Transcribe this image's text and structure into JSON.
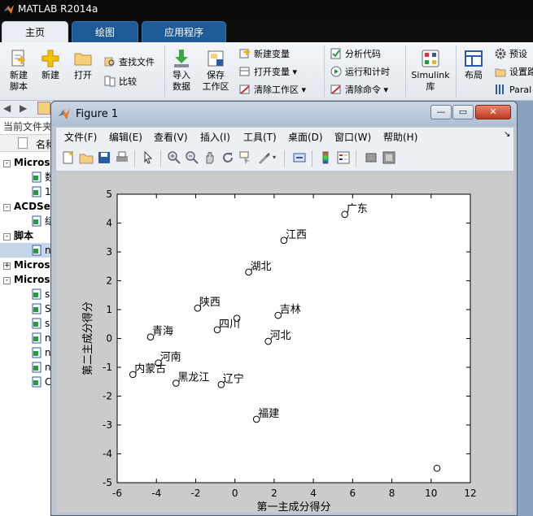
{
  "app": {
    "title": "MATLAB R2014a",
    "tabs": [
      {
        "label": "主页",
        "active": true
      },
      {
        "label": "绘图",
        "active": false
      },
      {
        "label": "应用程序",
        "active": false
      }
    ]
  },
  "ribbon": {
    "new_script": "新建\n脚本",
    "new": "新建",
    "open": "打开",
    "find_files": "查找文件",
    "compare": "比较",
    "import_data": "导入\n数据",
    "save_workspace": "保存\n工作区",
    "new_variable": "新建变量",
    "open_variable": "打开变量",
    "clear_workspace": "清除工作区",
    "analyze_code": "分析代码",
    "run_and_time": "运行和计时",
    "clear_commands": "清除命令",
    "simulink": "Simulink\n库",
    "layout": "布局",
    "preferences": "预设",
    "set_path": "设置路",
    "parallel": "Paral"
  },
  "left_panel": {
    "current_folder": "当前文件夹",
    "name_col": "名称",
    "rows": [
      {
        "type": "group",
        "expander": "-",
        "label": "Microso"
      },
      {
        "type": "file",
        "label": "数"
      },
      {
        "type": "file",
        "label": "1"
      },
      {
        "type": "group",
        "expander": "-",
        "label": "ACDSee"
      },
      {
        "type": "file",
        "label": "结"
      },
      {
        "type": "group",
        "expander": "-",
        "label": "脚本"
      },
      {
        "type": "file",
        "label": "n",
        "selected": true
      },
      {
        "type": "group",
        "expander": "+",
        "label": "Microso"
      },
      {
        "type": "group",
        "expander": "-",
        "label": "Microso"
      },
      {
        "type": "file",
        "label": "s"
      },
      {
        "type": "file",
        "label": "S"
      },
      {
        "type": "file",
        "label": "s"
      },
      {
        "type": "file",
        "label": "n"
      },
      {
        "type": "file",
        "label": "n"
      },
      {
        "type": "file",
        "label": "n"
      },
      {
        "type": "file",
        "label": "C"
      }
    ]
  },
  "figure": {
    "title": "Figure 1",
    "menus": [
      "文件(F)",
      "编辑(E)",
      "查看(V)",
      "插入(I)",
      "工具(T)",
      "桌面(D)",
      "窗口(W)",
      "帮助(H)"
    ],
    "window_buttons": [
      "minimize",
      "maximize",
      "close"
    ]
  },
  "chart_data": {
    "type": "scatter",
    "title": "",
    "xlabel": "第一主成分得分",
    "ylabel": "第二主成分得分",
    "xlim": [
      -6,
      12
    ],
    "ylim": [
      -5,
      5
    ],
    "xticks": [
      -6,
      -4,
      -2,
      0,
      2,
      4,
      6,
      8,
      10,
      12
    ],
    "yticks": [
      -5,
      -4,
      -3,
      -2,
      -1,
      0,
      1,
      2,
      3,
      4,
      5
    ],
    "grid": false,
    "marker": "circle",
    "points": [
      {
        "x": 5.6,
        "y": 4.3,
        "label": "广东"
      },
      {
        "x": 2.5,
        "y": 3.4,
        "label": "江西"
      },
      {
        "x": 0.7,
        "y": 2.3,
        "label": "湖北"
      },
      {
        "x": -1.9,
        "y": 1.05,
        "label": "陕西"
      },
      {
        "x": 2.2,
        "y": 0.8,
        "label": "吉林"
      },
      {
        "x": 0.1,
        "y": 0.7,
        "label": ""
      },
      {
        "x": -0.9,
        "y": 0.3,
        "label": "四川"
      },
      {
        "x": -4.3,
        "y": 0.05,
        "label": "青海"
      },
      {
        "x": 1.7,
        "y": -0.1,
        "label": "河北"
      },
      {
        "x": -3.9,
        "y": -0.85,
        "label": "河南"
      },
      {
        "x": -5.2,
        "y": -1.25,
        "label": "内蒙古"
      },
      {
        "x": -3.0,
        "y": -1.55,
        "label": "黑龙江"
      },
      {
        "x": -0.7,
        "y": -1.6,
        "label": "辽宁"
      },
      {
        "x": 1.1,
        "y": -2.8,
        "label": "福建"
      },
      {
        "x": 10.3,
        "y": -4.5,
        "label": ""
      }
    ]
  }
}
